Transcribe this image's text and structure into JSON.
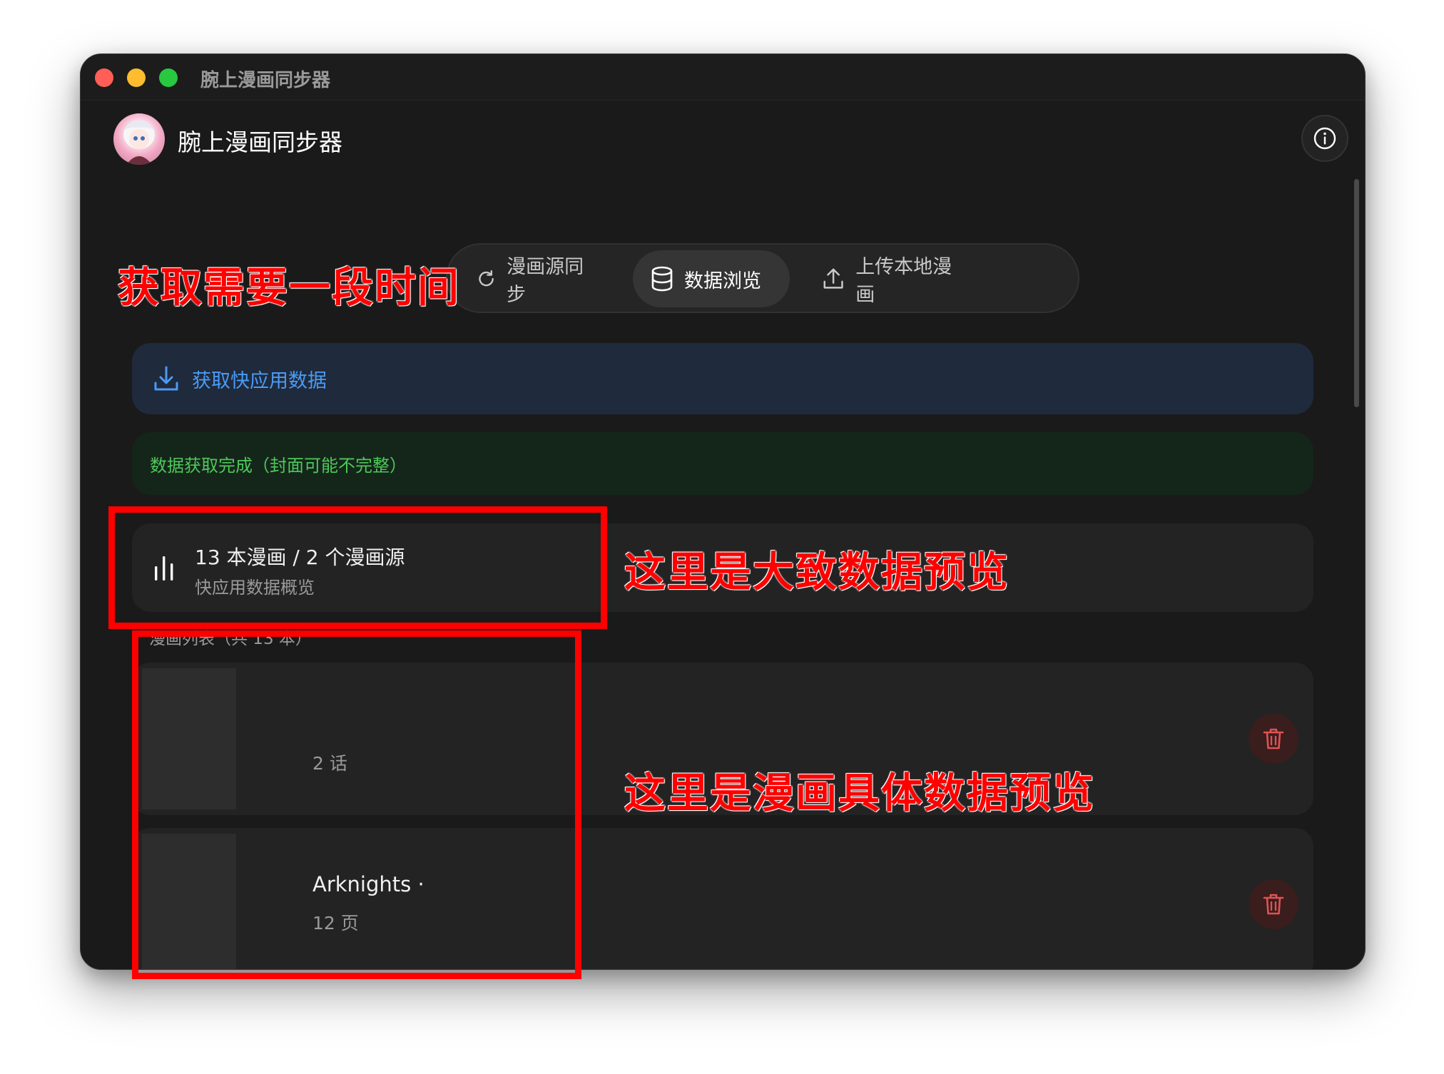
{
  "window": {
    "title": "腕上漫画同步器"
  },
  "header": {
    "app_title": "腕上漫画同步器"
  },
  "tabs": [
    {
      "label": "漫画源同步",
      "icon": "refresh-icon"
    },
    {
      "label": "数据浏览",
      "icon": "database-icon",
      "active": true
    },
    {
      "label": "上传本地漫画",
      "icon": "upload-icon"
    }
  ],
  "fetch": {
    "label": "获取快应用数据",
    "icon": "download-icon"
  },
  "status": {
    "text": "数据获取完成（封面可能不完整）"
  },
  "summary": {
    "main": "13 本漫画 / 2 个漫画源",
    "sub": "快应用数据概览",
    "icon": "bar-chart-icon"
  },
  "list": {
    "header": "漫画列表（共 13 本）",
    "items": [
      {
        "title": "",
        "meta": "2 话"
      },
      {
        "title": "Arknights ·",
        "meta": "12 页"
      }
    ]
  },
  "annotations": {
    "fetch_note": "获取需要一段时间",
    "summary_note": "这里是大致数据预览",
    "list_note": "这里是漫画具体数据预览"
  },
  "colors": {
    "accent": "#4a9bf5",
    "success": "#4ec85a",
    "annotation": "#ff0000",
    "danger": "#e05252"
  }
}
